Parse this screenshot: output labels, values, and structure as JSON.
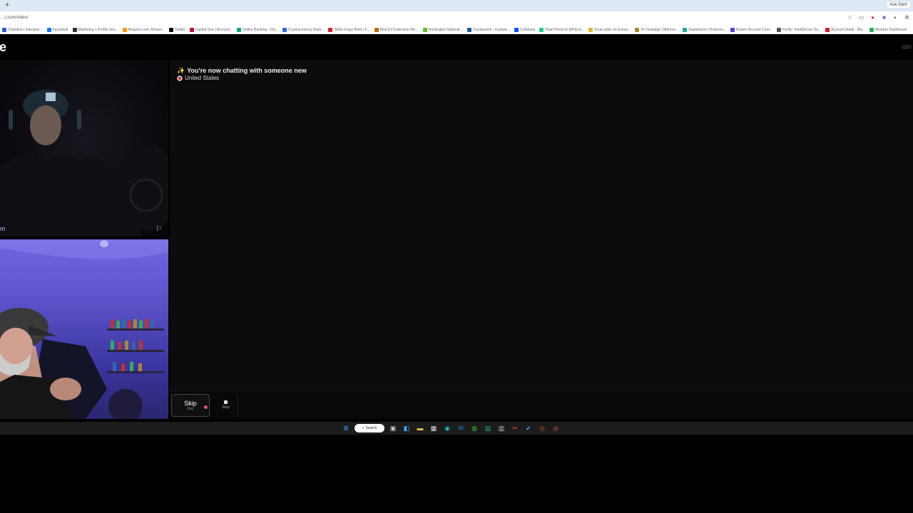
{
  "browser": {
    "new_tab": "+",
    "ask_button": "Ask Gem",
    "url": "...t.com/video/",
    "bookmarks": [
      {
        "label": "Chainlink | Interoper...",
        "color": "#2a5ada"
      },
      {
        "label": "Facebook",
        "color": "#1877f2"
      },
      {
        "label": "Marketing + Profile Sec...",
        "color": "#333"
      },
      {
        "label": "Amazon.com: Amazo...",
        "color": "#ff9900"
      },
      {
        "label": "Twitter",
        "color": "#111"
      },
      {
        "label": "Capital One | Account...",
        "color": "#c8102e"
      },
      {
        "label": "Online Banking - Citi...",
        "color": "#0a8"
      },
      {
        "label": "Cryptocurrency Mark...",
        "color": "#2d6be4"
      },
      {
        "label": "Wells Fargo Bank | F...",
        "color": "#d71e28"
      },
      {
        "label": "Best EV Extension Mo...",
        "color": "#c60"
      },
      {
        "label": "Huntington National...",
        "color": "#6b3"
      },
      {
        "label": "Transparent - Guitaris...",
        "color": "#2255aa"
      },
      {
        "label": "Coinbase",
        "color": "#0052ff"
      },
      {
        "label": "Pearl Protocol @Pecul...",
        "color": "#2c8"
      },
      {
        "label": "Tesla order on Extras...",
        "color": "#ddbb33"
      },
      {
        "label": "Dr. Nostalgic Offshore...",
        "color": "#aa8833"
      },
      {
        "label": "Dashboard | Pinterest...",
        "color": "#2a9"
      },
      {
        "label": "Kraken Account Cent...",
        "color": "#5741d9"
      },
      {
        "label": "Firefly: IntelliSense Da...",
        "color": "#555"
      },
      {
        "label": "Account Detail - Ma...",
        "color": "#c22"
      },
      {
        "label": "Member Dashboard",
        "color": "#3a6"
      }
    ]
  },
  "site": {
    "logo": "e"
  },
  "videos": {
    "top_label": "m",
    "flag_icon": "flag-icon"
  },
  "chat": {
    "system_message": "You're now chatting with someone new",
    "spark": "✨",
    "country": "United States"
  },
  "controls": {
    "skip_label": "Skip",
    "skip_key": "Esc",
    "stop_label": "Stop"
  },
  "taskbar": {
    "search_label": "Search"
  }
}
